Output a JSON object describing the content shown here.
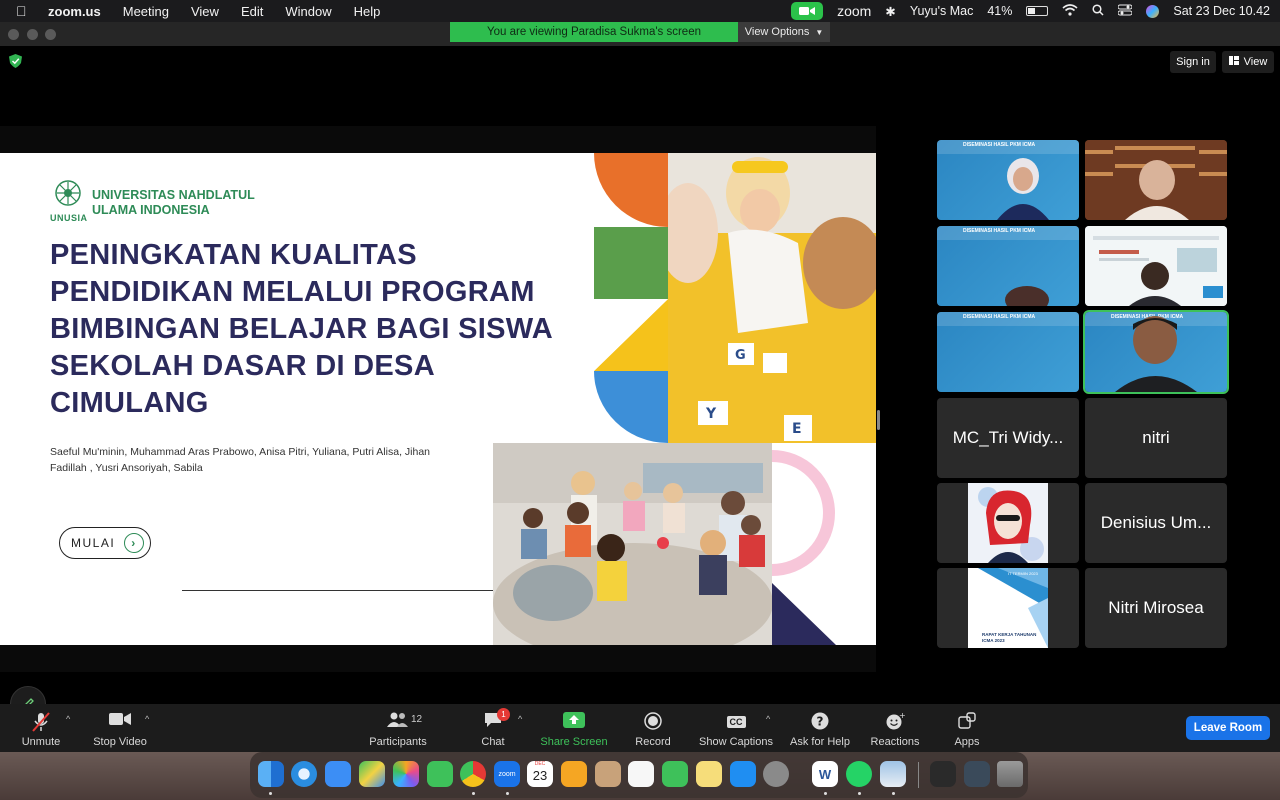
{
  "menubar": {
    "app_name": "zoom.us",
    "menus": [
      "Meeting",
      "View",
      "Edit",
      "Window",
      "Help"
    ],
    "zoom_label": "zoom",
    "device_name": "Yuyu's Mac",
    "battery": "41%",
    "battery_level": 0.41,
    "datetime": "Sat 23 Dec  10.42"
  },
  "window": {
    "viewing_banner": "You are viewing Paradisa Sukma's screen",
    "view_options": "View Options",
    "sign_in": "Sign in",
    "view": "View"
  },
  "slide": {
    "university": "UNIVERSITAS NAHDLATUL ULAMA INDONESIA",
    "logo_text": "UNUSIA",
    "title": "PENINGKATAN KUALITAS PENDIDIKAN MELALUI PROGRAM BIMBINGAN BELAJAR BAGI SISWA SEKOLAH DASAR DI DESA CIMULANG",
    "authors": "Saeful Mu'minin, Muhammad Aras Prabowo, Anisa Pitri, Yuliana, Putri Alisa, Jihan Fadillah , Yusri Ansoriyah, Sabila",
    "button": "MULAI",
    "colors": {
      "title": "#2b2a5c",
      "accent_green": "#2e8b57",
      "orange": "#e8702a",
      "green": "#5a9e4b",
      "yellow": "#f5c21b",
      "blue": "#3d8fd8",
      "pink": "#f7c6d9",
      "navy": "#2b2a5c"
    }
  },
  "gallery": {
    "presentation_header": "DISEMINASI HASIL PKM ICMA",
    "names": [
      "MC_Tri Widy...",
      "nitri",
      "Denisius Um...",
      "Nitri Mirosea"
    ],
    "doc_text_top": "IT TERMIN 2023",
    "doc_text_title": "RAPAT KERJA TAHUNAN ICMA 2023"
  },
  "toolbar": {
    "unmute": "Unmute",
    "stop_video": "Stop Video",
    "participants": "Participants",
    "participants_count": "12",
    "chat": "Chat",
    "chat_badge": "1",
    "share_screen": "Share Screen",
    "record": "Record",
    "show_captions": "Show Captions",
    "cc": "CC",
    "ask_for_help": "Ask for Help",
    "reactions": "Reactions",
    "apps": "Apps",
    "leave_room": "Leave Room"
  },
  "dock": {
    "calendar_month": "DEC",
    "calendar_day": "23",
    "zoom_icon_text": "zoom",
    "word_icon_text": "W"
  }
}
